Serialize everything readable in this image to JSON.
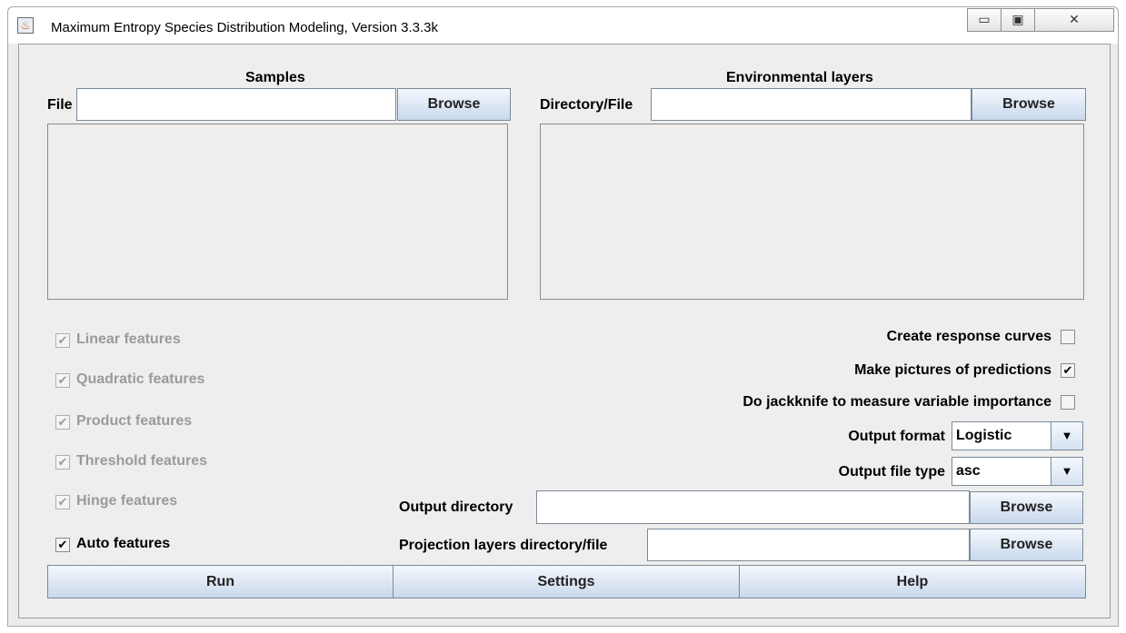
{
  "window": {
    "title": "Maximum Entropy Species Distribution Modeling, Version 3.3.3k",
    "minimize": "▭",
    "maximize": "▣",
    "close": "✕",
    "icon": "java-icon"
  },
  "samples": {
    "heading": "Samples",
    "file_label": "File",
    "file_value": "",
    "browse_label": "Browse"
  },
  "env": {
    "heading": "Environmental layers",
    "dir_label": "Directory/File",
    "dir_value": "",
    "browse_label": "Browse"
  },
  "features": [
    {
      "label": "Linear features",
      "checked": true,
      "enabled": false
    },
    {
      "label": "Quadratic features",
      "checked": true,
      "enabled": false
    },
    {
      "label": "Product features",
      "checked": true,
      "enabled": false
    },
    {
      "label": "Threshold features",
      "checked": true,
      "enabled": false
    },
    {
      "label": "Hinge features",
      "checked": true,
      "enabled": false
    },
    {
      "label": "Auto features",
      "checked": true,
      "enabled": true
    }
  ],
  "options": {
    "response_curves": {
      "label": "Create response curves",
      "checked": false
    },
    "pictures": {
      "label": "Make pictures of predictions",
      "checked": true
    },
    "jackknife": {
      "label": "Do jackknife to measure variable importance",
      "checked": false
    }
  },
  "output_format": {
    "label": "Output format",
    "value": "Logistic"
  },
  "output_file_type": {
    "label": "Output file type",
    "value": "asc"
  },
  "output_dir": {
    "label": "Output directory",
    "value": "",
    "browse_label": "Browse"
  },
  "projection": {
    "label": "Projection layers directory/file",
    "value": "",
    "browse_label": "Browse"
  },
  "actions": {
    "run": "Run",
    "settings": "Settings",
    "help": "Help"
  },
  "check_glyph": "✔"
}
